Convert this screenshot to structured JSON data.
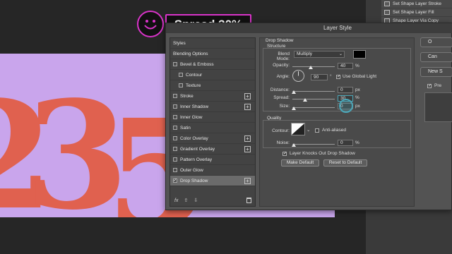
{
  "callout": {
    "text": "Spread 30%"
  },
  "layer_menu": {
    "items": [
      {
        "label": "Set Shape Layer Stroke"
      },
      {
        "label": "Set Shape Layer Fill"
      },
      {
        "label": "Shape Layer Via Copy"
      }
    ]
  },
  "canvas": {
    "glyphs": [
      "2",
      "3",
      "5"
    ]
  },
  "dialog": {
    "title": "Layer Style",
    "styles_list": [
      {
        "label": "Styles",
        "checkbox": false,
        "plus": false,
        "checked": false,
        "selected": false
      },
      {
        "label": "Blending Options",
        "checkbox": false,
        "plus": false,
        "checked": false,
        "selected": false
      },
      {
        "label": "Bevel & Emboss",
        "checkbox": true,
        "plus": false,
        "checked": false,
        "selected": false
      },
      {
        "label": "Contour",
        "checkbox": true,
        "plus": false,
        "checked": false,
        "selected": false,
        "indent": true
      },
      {
        "label": "Texture",
        "checkbox": true,
        "plus": false,
        "checked": false,
        "selected": false,
        "indent": true
      },
      {
        "label": "Stroke",
        "checkbox": true,
        "plus": true,
        "checked": false,
        "selected": false
      },
      {
        "label": "Inner Shadow",
        "checkbox": true,
        "plus": true,
        "checked": false,
        "selected": false
      },
      {
        "label": "Inner Glow",
        "checkbox": true,
        "plus": false,
        "checked": false,
        "selected": false
      },
      {
        "label": "Satin",
        "checkbox": true,
        "plus": false,
        "checked": false,
        "selected": false
      },
      {
        "label": "Color Overlay",
        "checkbox": true,
        "plus": true,
        "checked": false,
        "selected": false
      },
      {
        "label": "Gradient Overlay",
        "checkbox": true,
        "plus": true,
        "checked": false,
        "selected": false
      },
      {
        "label": "Pattern Overlay",
        "checkbox": true,
        "plus": false,
        "checked": false,
        "selected": false
      },
      {
        "label": "Outer Glow",
        "checkbox": true,
        "plus": false,
        "checked": false,
        "selected": false
      },
      {
        "label": "Drop Shadow",
        "checkbox": true,
        "plus": true,
        "checked": true,
        "selected": true
      }
    ],
    "footer": {
      "fx_label": "fx"
    },
    "drop_shadow": {
      "section_title": "Drop Shadow",
      "structure_title": "Structure",
      "blend_mode_label": "Blend Mode:",
      "blend_mode_value": "Multiply",
      "opacity_label": "Opacity:",
      "opacity_value": "40",
      "angle_label": "Angle:",
      "angle_value": "90",
      "use_global_light_label": "Use Global Light",
      "distance_label": "Distance:",
      "distance_value": "0",
      "spread_label": "Spread:",
      "spread_value": "30",
      "size_label": "Size:",
      "size_value": "0",
      "unit_percent": "%",
      "unit_px": "px",
      "degree_symbol": "°",
      "quality_title": "Quality",
      "contour_label": "Contour:",
      "anti_aliased_label": "Anti-aliased",
      "noise_label": "Noise:",
      "noise_value": "0",
      "knockout_label": "Layer Knocks Out Drop Shadow",
      "make_default_label": "Make Default",
      "reset_default_label": "Reset to Default",
      "shadow_color": "#000000"
    },
    "side_buttons": {
      "ok_label": "O",
      "cancel_label": "Can",
      "new_style_label": "New S",
      "preview_label": "Pre"
    }
  },
  "colors": {
    "canvas_bg": "#c9a5ec",
    "glyph_color": "#e0614f",
    "callout_accent": "#d933c9"
  }
}
